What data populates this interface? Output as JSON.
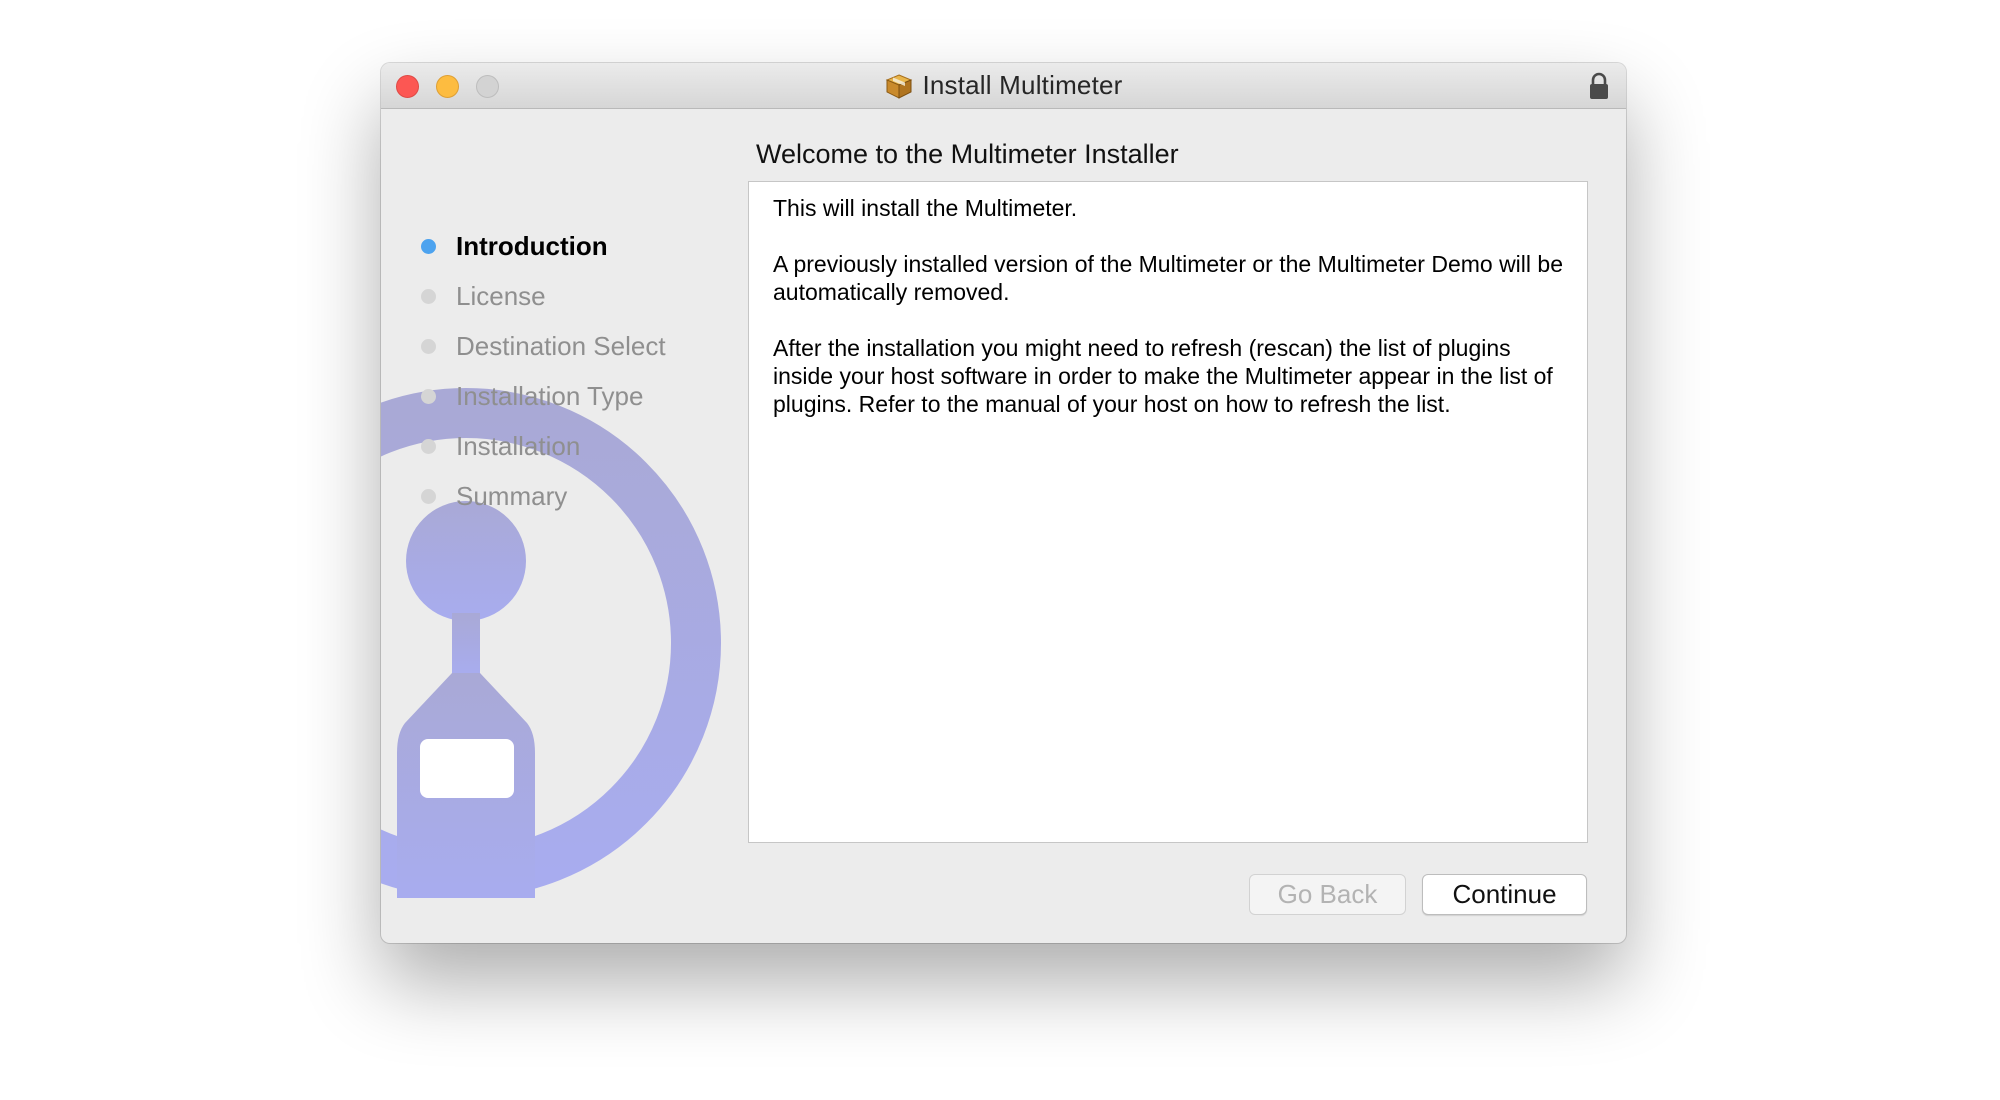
{
  "window": {
    "title": "Install Multimeter",
    "title_icon": "package-icon",
    "lock_icon": "lock-icon"
  },
  "sidebar": {
    "steps": [
      {
        "label": "Introduction",
        "active": true
      },
      {
        "label": "License",
        "active": false
      },
      {
        "label": "Destination Select",
        "active": false
      },
      {
        "label": "Installation Type",
        "active": false
      },
      {
        "label": "Installation",
        "active": false
      },
      {
        "label": "Summary",
        "active": false
      }
    ],
    "artwork": "multimeter-logo-icon",
    "colors": {
      "active_dot": "#4da3ef",
      "logo": "#aaacdf"
    }
  },
  "main": {
    "heading": "Welcome to the Multimeter Installer",
    "paragraphs": [
      "This will install the Multimeter.",
      "A previously installed version of the Multimeter or the Multimeter Demo will be automatically removed.",
      "After the installation you might need to refresh (rescan) the list of plugins inside your host software in order to make the Multimeter appear in the list of plugins. Refer to the manual of your host on how to refresh the list."
    ]
  },
  "buttons": {
    "go_back": "Go Back",
    "continue": "Continue"
  }
}
